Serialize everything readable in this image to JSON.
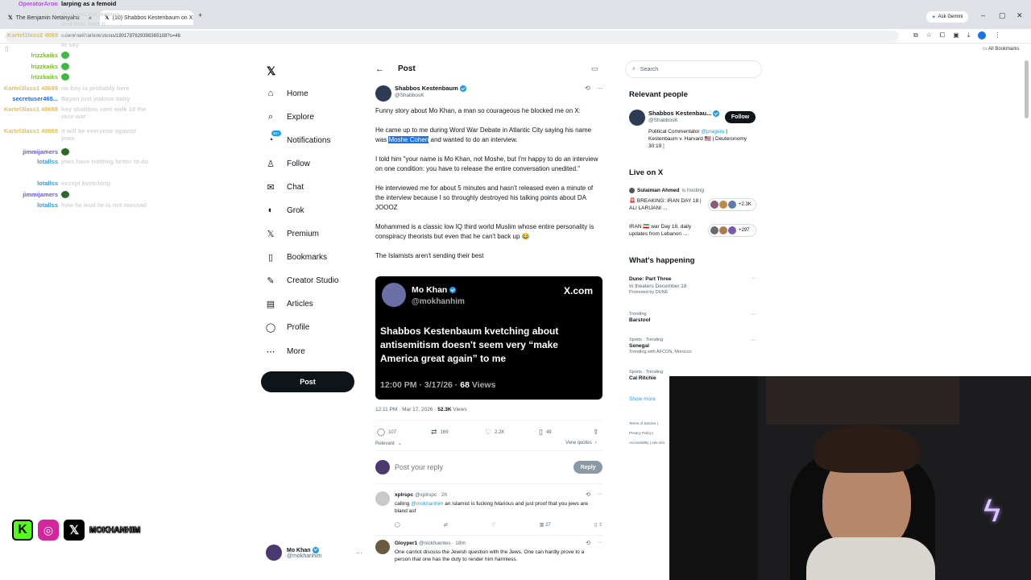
{
  "browser": {
    "tabs": [
      {
        "label": "The Benjamin Netanyahu"
      },
      {
        "label": "(10) Shabbos Kestenbaum on X"
      }
    ],
    "url": "x.com/mokhanhim/status/1901787629398365108?s=46",
    "gemini_label": "Ask Gemini",
    "bookmarks_label": "All Bookmarks"
  },
  "chat": [
    {
      "user": "OperatorAron",
      "msg": "larping as a femoid",
      "color": "#b44cff"
    },
    {
      "user": "",
      "msg": "they just got jealous",
      "color": ""
    },
    {
      "user": "",
      "msg": "and they hate it",
      "color": ""
    },
    {
      "user": "Kartel3lass2 4069",
      "msg": "whom did he ever",
      "color": "#e0c060"
    },
    {
      "user": "",
      "msg": "to say",
      "color": ""
    },
    {
      "user": "lrizzkaiks",
      "msg": "",
      "color": "#7cbb2f"
    },
    {
      "user": "lrizzkaiks",
      "msg": "",
      "color": "#7cbb2f"
    },
    {
      "user": "lrizzkaiks",
      "msg": "",
      "color": "#7cbb2f"
    },
    {
      "user": "Kartel3lass1 40698",
      "msg": "no boy is probably here",
      "color": "#e0c060"
    },
    {
      "user": "secretuser465...",
      "msg": "Bayan just jealous baby",
      "color": "#2a6ad8"
    },
    {
      "user": "Kartel3lass1 40698",
      "msg": "hey shabbos cant walk 10 the race war",
      "color": "#e0c060"
    },
    {
      "user": "Kartel3lass1 40698",
      "msg": "it will be everyone against jews",
      "color": "#e0c060"
    },
    {
      "user": "jimmijamers",
      "msg": "",
      "color": "#6a5ad8"
    },
    {
      "user": "lotallss",
      "msg": "jews have nothing better to do",
      "color": "#3f9ad8"
    },
    {
      "user": "lotallss",
      "msg": "except kvetching",
      "color": "#3f9ad8"
    },
    {
      "user": "jimmijamers",
      "msg": "",
      "color": "#6a5ad8"
    },
    {
      "user": "lotallss",
      "msg": "how he wud lie is not mossad",
      "color": "#3f9ad8"
    }
  ],
  "streamer_socials": {
    "handle": "MOKHANHIM"
  },
  "nav": {
    "items": [
      {
        "label": "Home",
        "icon": "home-icon"
      },
      {
        "label": "Explore",
        "icon": "search-icon"
      },
      {
        "label": "Notifications",
        "icon": "bell-icon",
        "badge": "20+"
      },
      {
        "label": "Follow",
        "icon": "follow-icon"
      },
      {
        "label": "Chat",
        "icon": "mail-icon"
      },
      {
        "label": "Grok",
        "icon": "grok-icon"
      },
      {
        "label": "Premium",
        "icon": "x-premium-icon"
      },
      {
        "label": "Bookmarks",
        "icon": "bookmark-icon"
      },
      {
        "label": "Creator Studio",
        "icon": "creator-icon"
      },
      {
        "label": "Articles",
        "icon": "articles-icon"
      },
      {
        "label": "Profile",
        "icon": "profile-icon"
      },
      {
        "label": "More",
        "icon": "more-icon"
      }
    ],
    "post_button": "Post",
    "account": {
      "name": "Mo Khan",
      "handle": "@mokhanhim"
    }
  },
  "post": {
    "header": "Post",
    "author": {
      "name": "Shabbos Kestenbaum",
      "handle": "@ShabbosK"
    },
    "paragraphs": [
      {
        "text": "Funny story about Mo Khan, a man so courageous he blocked me on X:"
      },
      {
        "before": "He came up to me during Word War Debate in Atlantic City saying his name was ",
        "highlight": "Moshe Cohen",
        "after": " and wanted to do an interview."
      },
      {
        "text": "I told him \"your name is Mo Khan, not Moshe, but I'm happy to do an interview on one condition: you have to release the entire conversation unedited.\""
      },
      {
        "text": "He interviewed me for about 5 minutes and hasn't released even a minute of the interview because I so throughly destroyed his talking points about DA JOOOZ"
      },
      {
        "text": "Mohammed is a classic low IQ third world Muslim whose entire personality is conspiracy theorists but even that he can't back up 😂"
      },
      {
        "text": "The Islamists aren't sending their best"
      }
    ],
    "card": {
      "name": "Mo Khan",
      "handle": "@mokhanhim",
      "brand": "X.com",
      "text": "Shabbos Kestenbaum kvetching about antisemitism doesn't seem very “make America great again” to me",
      "time": "12:00 PM · 3/17/26 ·",
      "views_num": "68",
      "views_label": "Views"
    },
    "timestamp": "12:11 PM · Mar 17, 2026 ·",
    "views_num": "52.3K",
    "views_label": "Views",
    "stats": {
      "replies": "107",
      "reposts": "169",
      "likes": "2.2K",
      "bookmarks": "49"
    },
    "sort_label": "Relevant",
    "view_quotes": "View quotes",
    "reply_placeholder": "Post your reply",
    "reply_button": "Reply"
  },
  "replies": [
    {
      "name": "xplrspc",
      "handle": "@xplrspc · 2h",
      "text_before": "calling ",
      "mention": "@mokhanhim",
      "text_after": " an islamist is fucking hilarious and just proof that you jews are bland asf",
      "views": "27"
    },
    {
      "name": "Gloyper1",
      "handle": "@nickfuentes · 18m",
      "text_before": "One cannot discuss the Jewish question with the Jews. One can hardly prove to a person that one has the duty to render him harmless.",
      "mention": "",
      "text_after": "",
      "views": ""
    }
  ],
  "sidebar": {
    "search_placeholder": "Search",
    "relevant_title": "Relevant people",
    "person": {
      "name": "Shabbos Kestenbau...",
      "handle": "@ShabbosK",
      "bio_before": "Political Commentator ",
      "bio_mention": "@prageru",
      "bio_after": " | Kestenbaum v. Harvard 🇺🇸 | Deuteronomy 30:19 ¦",
      "follow": "Follow"
    },
    "live_title": "Live on X",
    "live_host": "Sulaiman Ahmed",
    "live_host_suffix": "is hosting",
    "lives": [
      {
        "title": "🚨 BREAKING: IRAN DAY 18 | ALI LARIJANI ...",
        "count": "+2.3K"
      },
      {
        "title": "IRAN 🇮🇷 war Day 18, daily updates from Lebanon ...",
        "count": "+297"
      }
    ],
    "happening_title": "What's happening",
    "trends": [
      {
        "title": "Dune: Part Three",
        "sub1": "In theaters December 18",
        "sub2": "Promoted by DUNE"
      },
      {
        "pre": "Trending",
        "title": "Barstool",
        "sub1": ""
      },
      {
        "pre": "Sports · Trending",
        "title": "Senegal",
        "sub1": "Trending with AFCON, Morocco"
      },
      {
        "pre": "Sports · Trending",
        "title": "Cal Ritchie",
        "sub1": ""
      }
    ],
    "show_more": "Show more",
    "footer": "Terms of Service  |  Privacy Policy  |  Accessibility  |  Ads info"
  },
  "colors": {
    "accent": "#1d9bf0",
    "highlight": "#1a73e8",
    "text": "#0f1419",
    "muted": "#536471"
  }
}
